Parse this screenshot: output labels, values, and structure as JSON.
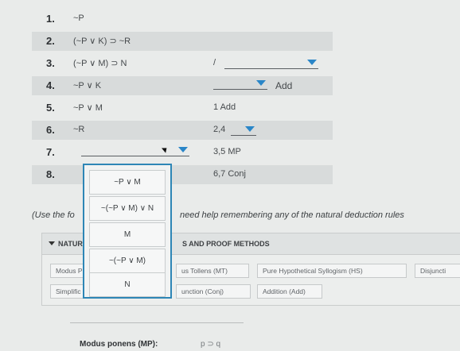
{
  "proof": {
    "rows": [
      {
        "num": "1.",
        "statement": "~P",
        "justification": ""
      },
      {
        "num": "2.",
        "statement": "(~P ∨ K) ⊃ ~R",
        "justification": ""
      },
      {
        "num": "3.",
        "statement": "(~P ∨ M) ⊃ N",
        "justification": "/"
      },
      {
        "num": "4.",
        "statement": "~P ∨ K",
        "justification": "Add"
      },
      {
        "num": "5.",
        "statement": "~P ∨ M",
        "justification": "1 Add"
      },
      {
        "num": "6.",
        "statement": "~R",
        "justification": "2,4"
      },
      {
        "num": "7.",
        "statement": "",
        "justification": "3,5 MP"
      },
      {
        "num": "8.",
        "statement": "",
        "justification": "6,7 Conj"
      }
    ]
  },
  "dropdown": {
    "options": [
      "~P ∨ M",
      "~(~P ∨ M) ∨ N",
      "M",
      "~(~P ∨ M)",
      "N"
    ]
  },
  "instructions": {
    "left": "(Use the fo",
    "right": "need help remembering any of the natural deduction rules"
  },
  "panel": {
    "title_left": "NATUR",
    "title_right": "S AND PROOF METHODS",
    "rule_buttons_row1": [
      "Modus P",
      "us Tollens (MT)",
      "Pure Hypothetical Syllogism (HS)",
      "Disjuncti"
    ],
    "rule_buttons_row2": [
      "Simplific",
      "unction (Conj)",
      "Addition (Add)"
    ]
  },
  "footer": {
    "rule_label": "Modus ponens (MP):",
    "rule_value": "p ⊃ q"
  },
  "colors": {
    "accent": "#2a86c8",
    "dropdown_border": "#2e86b6"
  }
}
